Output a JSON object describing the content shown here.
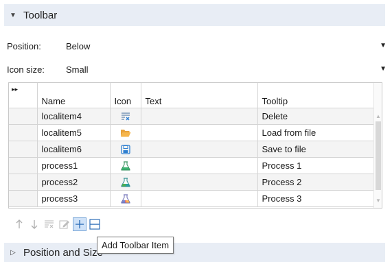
{
  "toolbar_section": {
    "title": "Toolbar",
    "expanded": true
  },
  "position_field": {
    "label": "Position:",
    "value": "Below"
  },
  "iconsize_field": {
    "label": "Icon size:",
    "value": "Small"
  },
  "grid": {
    "corner_glyph": "▸▸",
    "columns": [
      "Name",
      "Icon",
      "Text",
      "Tooltip"
    ],
    "rows": [
      {
        "name": "localitem4",
        "icon": "delete-list-icon",
        "text": "",
        "tooltip": "Delete"
      },
      {
        "name": "localitem5",
        "icon": "open-folder-icon",
        "text": "",
        "tooltip": "Load from file"
      },
      {
        "name": "localitem6",
        "icon": "floppy-save-icon",
        "text": "",
        "tooltip": "Save to file"
      },
      {
        "name": "process1",
        "icon": "flask-green-icon",
        "text": "",
        "tooltip": "Process 1"
      },
      {
        "name": "process2",
        "icon": "flask-teal-icon",
        "text": "",
        "tooltip": "Process 2"
      },
      {
        "name": "process3",
        "icon": "flask-multicolor-icon",
        "text": "",
        "tooltip": "Process 3"
      }
    ]
  },
  "table_toolbar": {
    "buttons": [
      {
        "name": "move-up",
        "icon": "arrow-up-icon",
        "enabled": false
      },
      {
        "name": "move-down",
        "icon": "arrow-down-icon",
        "enabled": false
      },
      {
        "name": "delete",
        "icon": "delete-list-icon",
        "enabled": false
      },
      {
        "name": "edit",
        "icon": "edit-icon",
        "enabled": false
      },
      {
        "name": "add-toolbar-item",
        "icon": "plus-icon",
        "enabled": true,
        "active": true
      },
      {
        "name": "add-separator",
        "icon": "separator-icon",
        "enabled": true
      }
    ]
  },
  "tooltip": {
    "text": "Add Toolbar Item"
  },
  "position_size_section": {
    "title": "Position and Size",
    "expanded": false
  },
  "colors": {
    "header_bg": "#e8edf5",
    "accent_blue": "#2f7fd1",
    "active_button_bg": "#cfe2f8"
  }
}
